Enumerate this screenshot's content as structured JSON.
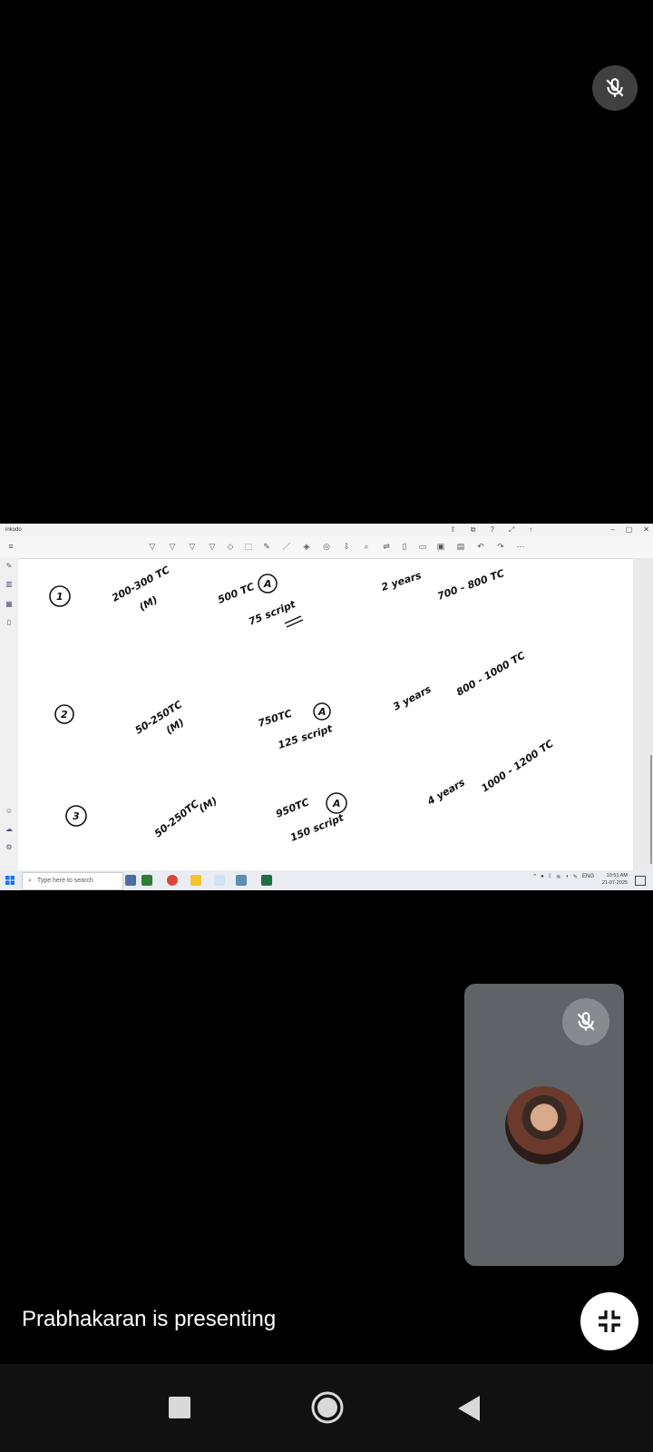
{
  "top_mic": {
    "icon": "mic-off-icon"
  },
  "shared_screen": {
    "app_title": "inkodo",
    "window_controls": [
      "–",
      "▢",
      "✕"
    ],
    "notes": {
      "rows": [
        {
          "num": "1",
          "range_m": "200-300 TC",
          "m": "(M)",
          "auto": "500 TC",
          "a": "A",
          "script": "75 script",
          "years": "2 years",
          "salary": "700 - 800 TC"
        },
        {
          "num": "2",
          "range_m": "50-250TC",
          "m": "(M)",
          "auto": "750TC",
          "a": "A",
          "script": "125 script",
          "years": "3 years",
          "salary": "800 - 1000 TC"
        },
        {
          "num": "3",
          "range_m": "50-250TC",
          "m": "(M)",
          "auto": "950TC",
          "a": "A",
          "script": "150 script",
          "years": "4 years",
          "salary": "1000 - 1200 TC"
        }
      ]
    },
    "taskbar": {
      "search_placeholder": "Type here to search",
      "time": "10:51 AM",
      "date": "21-07-2025",
      "lang": "ENG"
    }
  },
  "participant": {
    "mic": "mic-off-icon"
  },
  "status": {
    "presenting_text": "Prabhakaran is presenting"
  },
  "colors": {
    "background": "#000000",
    "tile": "#5f6368",
    "shared_bg": "#ffffff"
  }
}
